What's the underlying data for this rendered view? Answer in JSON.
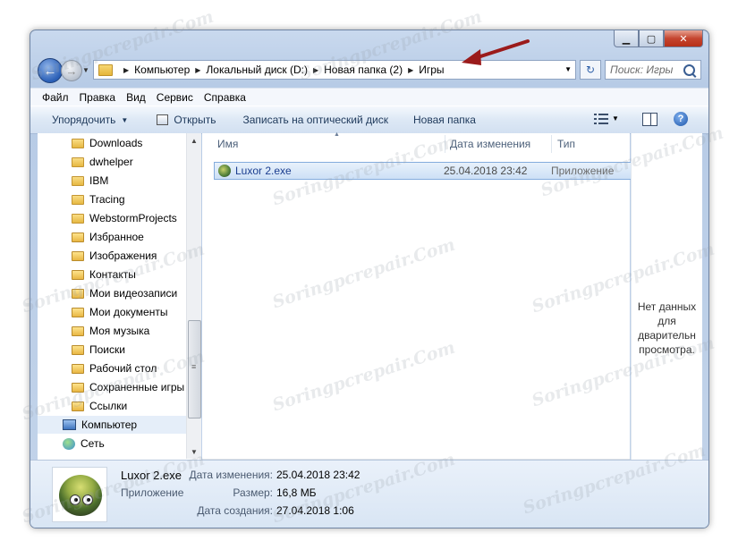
{
  "window": {
    "caption_buttons": {
      "minimize": "▁",
      "maximize": "▢",
      "close": "✕"
    }
  },
  "address": {
    "crumbs": [
      "Компьютер",
      "Локальный диск (D:)",
      "Новая папка (2)",
      "Игры"
    ],
    "search_placeholder": "Поиск: Игры"
  },
  "menu": [
    "Файл",
    "Правка",
    "Вид",
    "Сервис",
    "Справка"
  ],
  "toolbar": {
    "organize": "Упорядочить",
    "open": "Открыть",
    "burn": "Записать на оптический диск",
    "new_folder": "Новая папка"
  },
  "nav_pane": {
    "items": [
      {
        "label": "Downloads",
        "kind": "folder"
      },
      {
        "label": "dwhelper",
        "kind": "folder"
      },
      {
        "label": "IBM",
        "kind": "folder"
      },
      {
        "label": "Tracing",
        "kind": "folder"
      },
      {
        "label": "WebstormProjects",
        "kind": "folder"
      },
      {
        "label": "Избранное",
        "kind": "special"
      },
      {
        "label": "Изображения",
        "kind": "special"
      },
      {
        "label": "Контакты",
        "kind": "special"
      },
      {
        "label": "Мои видеозаписи",
        "kind": "special"
      },
      {
        "label": "Мои документы",
        "kind": "special"
      },
      {
        "label": "Моя музыка",
        "kind": "special"
      },
      {
        "label": "Поиски",
        "kind": "special"
      },
      {
        "label": "Рабочий стол",
        "kind": "special"
      },
      {
        "label": "Сохраненные игры",
        "kind": "special"
      },
      {
        "label": "Ссылки",
        "kind": "special"
      },
      {
        "label": "Компьютер",
        "kind": "computer"
      },
      {
        "label": "Сеть",
        "kind": "network"
      }
    ]
  },
  "columns": {
    "name": "Имя",
    "date": "Дата изменения",
    "type": "Тип"
  },
  "files": [
    {
      "name": "Luxor 2.exe",
      "date": "25.04.2018 23:42",
      "type": "Приложение"
    }
  ],
  "preview": {
    "text": "Нет данных для дварительн просмотра."
  },
  "details": {
    "name": "Luxor 2.exe",
    "type": "Приложение",
    "modified_label": "Дата изменения:",
    "modified_value": "25.04.2018 23:42",
    "size_label": "Размер:",
    "size_value": "16,8 МБ",
    "created_label": "Дата создания:",
    "created_value": "27.04.2018 1:06"
  },
  "watermark": "Soringpcrepair.Com",
  "colors": {
    "annotation_arrow": "#9b1b1b",
    "selection": "#cde0f6"
  }
}
